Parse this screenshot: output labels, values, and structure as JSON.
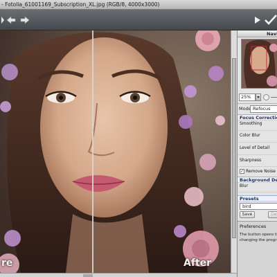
{
  "window": {
    "title": "- Fotolia_61001169_Subscription_XL.jpg (RGB/8, 4000x3000)"
  },
  "toolbar": {
    "undo_icon": "arrow-left-icon",
    "redo_icon": "arrow-right-icon",
    "run_icon": "play-icon",
    "apply_icon": "checkmark-icon"
  },
  "canvas": {
    "before_label": "re",
    "after_label": "After"
  },
  "panel": {
    "navigator_title": "Navi",
    "zoom_value": "25%",
    "mode_label": "Mode:",
    "mode_value": "Refocus",
    "focus_correction": {
      "title": "Focus Correction",
      "params": [
        "Smoothing",
        "Color Blur",
        "Level of Detail",
        "Sharpness"
      ]
    },
    "remove_noise": {
      "label": "Remove Noise",
      "checked": true
    },
    "background_defocus": {
      "title": "Background Defocus",
      "params": [
        "Blur"
      ]
    },
    "presets": {
      "title": "Presets",
      "value": "bird",
      "save_label": "Save",
      "delete_label": "Del"
    },
    "preferences": {
      "title": "Preferences",
      "text_line1": "The button opens the Pre",
      "text_line2": "changing the program's op"
    }
  }
}
